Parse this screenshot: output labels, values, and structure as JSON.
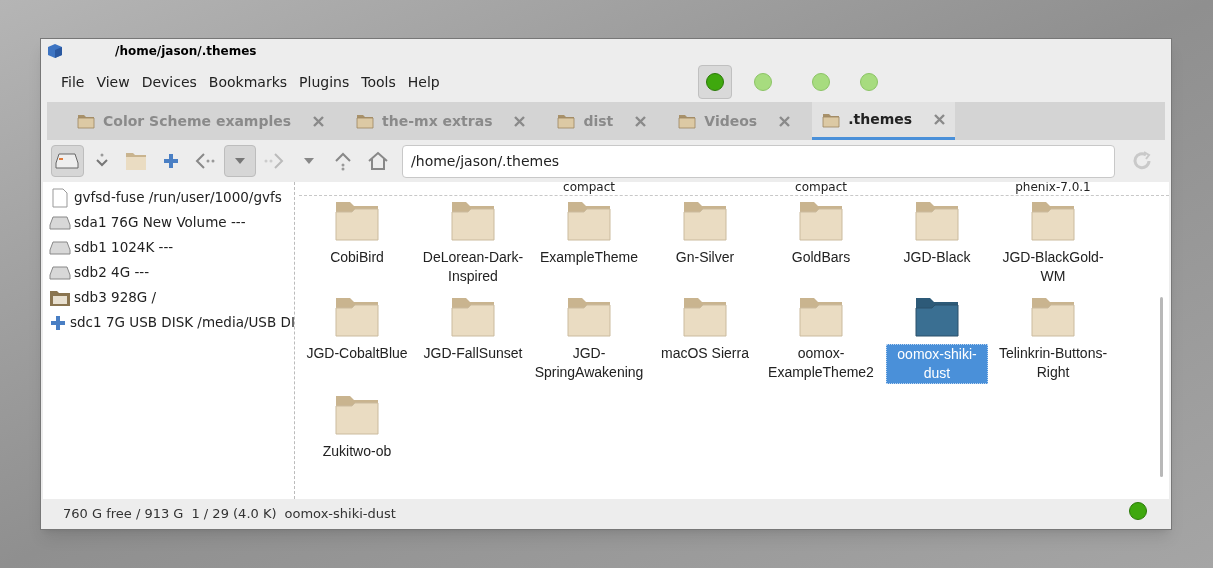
{
  "window": {
    "title": "/home/jason/.themes"
  },
  "menu": [
    "File",
    "View",
    "Devices",
    "Bookmarks",
    "Plugins",
    "Tools",
    "Help"
  ],
  "indicators": [
    {
      "selected": true
    },
    {
      "selected": false
    },
    {
      "selected": false
    },
    {
      "selected": false
    }
  ],
  "tabs": [
    {
      "label": "Color Scheme examples",
      "selected": false
    },
    {
      "label": "the-mx extras",
      "selected": false
    },
    {
      "label": "dist",
      "selected": false
    },
    {
      "label": "Videos",
      "selected": false
    },
    {
      "label": ".themes",
      "selected": true
    }
  ],
  "toolbar": {
    "path": "/home/jason/.themes"
  },
  "sidebar": {
    "items": [
      {
        "kind": "file",
        "label": "gvfsd-fuse /run/user/1000/gvfs"
      },
      {
        "kind": "drive",
        "label": "sda1 76G New Volume ---"
      },
      {
        "kind": "drive",
        "label": "sdb1 1024K ---"
      },
      {
        "kind": "drive",
        "label": "sdb2 4G ---"
      },
      {
        "kind": "mounted",
        "label": "sdb3 928G /"
      },
      {
        "kind": "add",
        "label": "sdc1 7G USB DISK /media/USB DI"
      }
    ]
  },
  "top_row_labels": [
    "compact",
    "compact",
    "phenix-7.0.1"
  ],
  "folders": [
    {
      "name": "CobiBird",
      "selected": false
    },
    {
      "name": "DeLorean-Dark-Inspired",
      "selected": false
    },
    {
      "name": "ExampleTheme",
      "selected": false
    },
    {
      "name": "Gn-Silver",
      "selected": false
    },
    {
      "name": "GoldBars",
      "selected": false
    },
    {
      "name": "JGD-Black",
      "selected": false
    },
    {
      "name": "JGD-BlackGold-WM",
      "selected": false
    },
    {
      "name": "JGD-CobaltBlue",
      "selected": false
    },
    {
      "name": "JGD-FallSunset",
      "selected": false
    },
    {
      "name": "JGD-SpringAwakening",
      "selected": false
    },
    {
      "name": "macOS Sierra",
      "selected": false
    },
    {
      "name": "oomox-ExampleTheme2",
      "selected": false
    },
    {
      "name": "oomox-shiki-dust",
      "selected": true
    },
    {
      "name": "Telinkrin-Buttons-Right",
      "selected": false
    },
    {
      "name": "Zukitwo-ob",
      "selected": false
    }
  ],
  "status_bar": {
    "space": "760 G free / 913 G",
    "count": "1 / 29 (4.0 K)",
    "selection": "oomox-shiki-dust"
  }
}
